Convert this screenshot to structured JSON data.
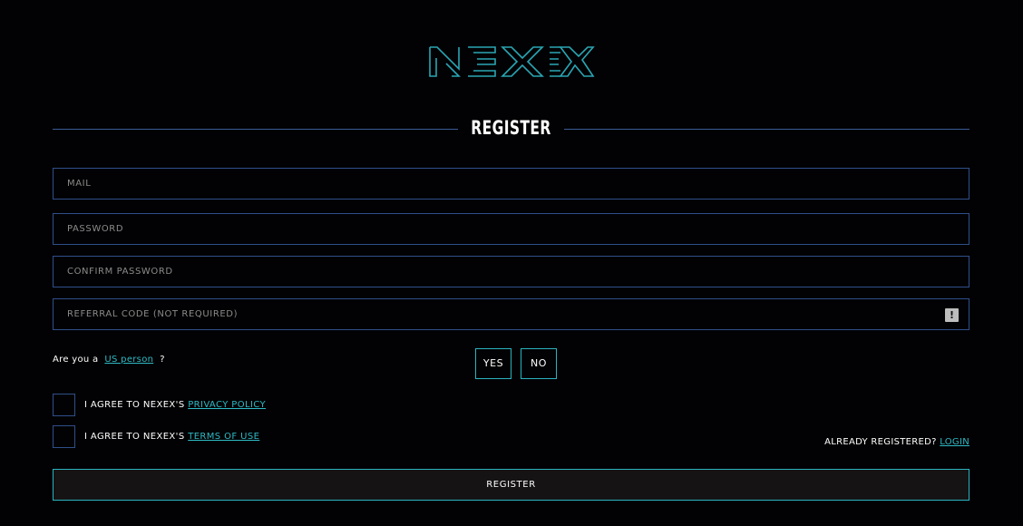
{
  "brand": {
    "logo_text": "NEXEX",
    "accent_color": "#2ab3bf",
    "border_color": "#2f4f8a"
  },
  "page": {
    "title": "REGISTER"
  },
  "form": {
    "mail_placeholder": "MAIL",
    "password_placeholder": "PASSWORD",
    "confirm_password_placeholder": "CONFIRM PASSWORD",
    "referral_placeholder": "REFERRAL CODE (NOT REQUIRED)",
    "referral_info_icon": "!",
    "us_person_prefix": "Are you a",
    "us_person_link": "US person",
    "us_person_suffix": "?",
    "yes_label": "YES",
    "no_label": "NO",
    "privacy_prefix": "I AGREE TO NEXEX'S",
    "privacy_link": "PRIVACY POLICY",
    "terms_prefix": "I AGREE TO NEXEX'S",
    "terms_link": "TERMS OF USE",
    "already_registered": "ALREADY REGISTERED?",
    "login_link": "LOGIN",
    "submit_label": "REGISTER"
  }
}
